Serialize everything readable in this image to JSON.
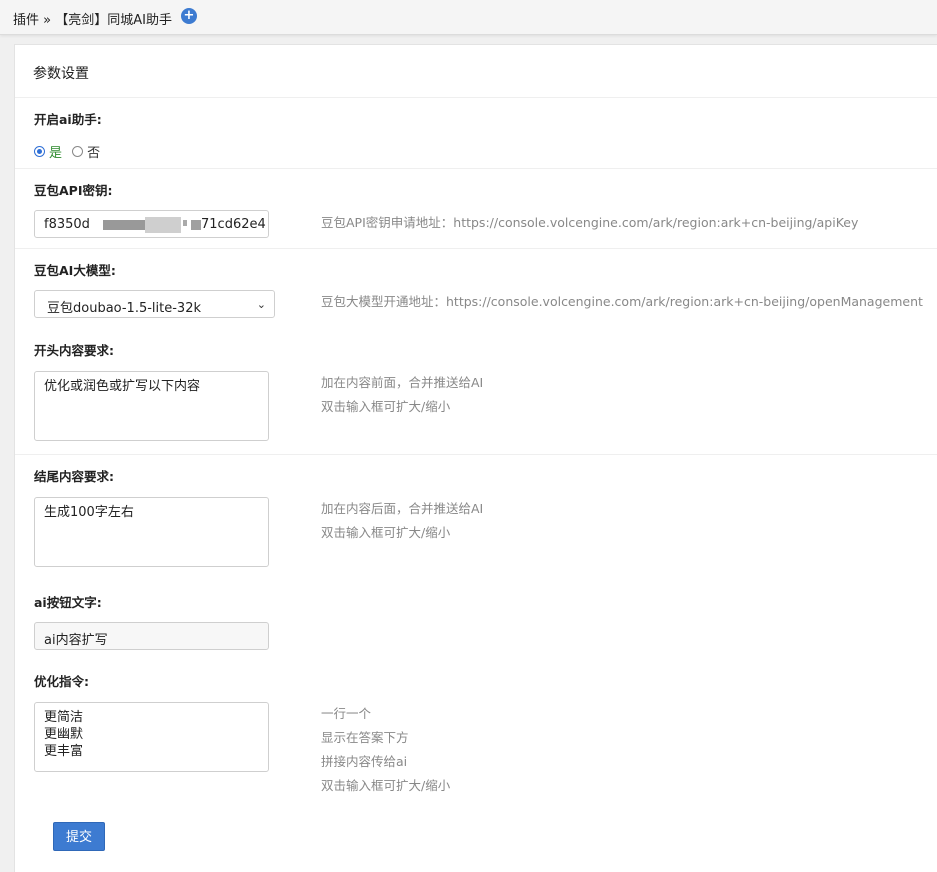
{
  "breadcrumb": {
    "text": "插件 » 【亮剑】同城AI助手",
    "icon": "plus-circle-icon"
  },
  "panel": {
    "title": "参数设置"
  },
  "enable_ai": {
    "label": "开启ai助手:",
    "options": [
      {
        "label": "是",
        "checked": true
      },
      {
        "label": "否",
        "checked": false
      }
    ]
  },
  "api_key": {
    "label": "豆包API密钥:",
    "value_start": "f8350d",
    "value_end": "71cd62e4",
    "help": "豆包API密钥申请地址：https://console.volcengine.com/ark/region:ark+cn-beijing/apiKey"
  },
  "model": {
    "label": "豆包AI大模型:",
    "selected": "豆包doubao-1.5-lite-32k",
    "help": "豆包大模型开通地址：https://console.volcengine.com/ark/region:ark+cn-beijing/openManagement"
  },
  "prefix": {
    "label": "开头内容要求:",
    "value": "优化或润色或扩写以下内容",
    "help1": "加在内容前面，合并推送给AI",
    "help2": "双击输入框可扩大/缩小"
  },
  "suffix": {
    "label": "结尾内容要求:",
    "value": "生成100字左右",
    "help1": "加在内容后面，合并推送给AI",
    "help2": "双击输入框可扩大/缩小"
  },
  "button_text": {
    "label": "ai按钮文字:",
    "value": "ai内容扩写"
  },
  "commands": {
    "label": "优化指令:",
    "lines": [
      "更简洁",
      "更幽默",
      "更丰富"
    ],
    "help": [
      "一行一个",
      "显示在答案下方",
      "拼接内容传给ai",
      "双击输入框可扩大/缩小"
    ]
  },
  "submit_label": "提交",
  "colors": {
    "primary": "#3d7bd1",
    "checked_text": "#2e8b2e",
    "help_text": "#888888"
  }
}
